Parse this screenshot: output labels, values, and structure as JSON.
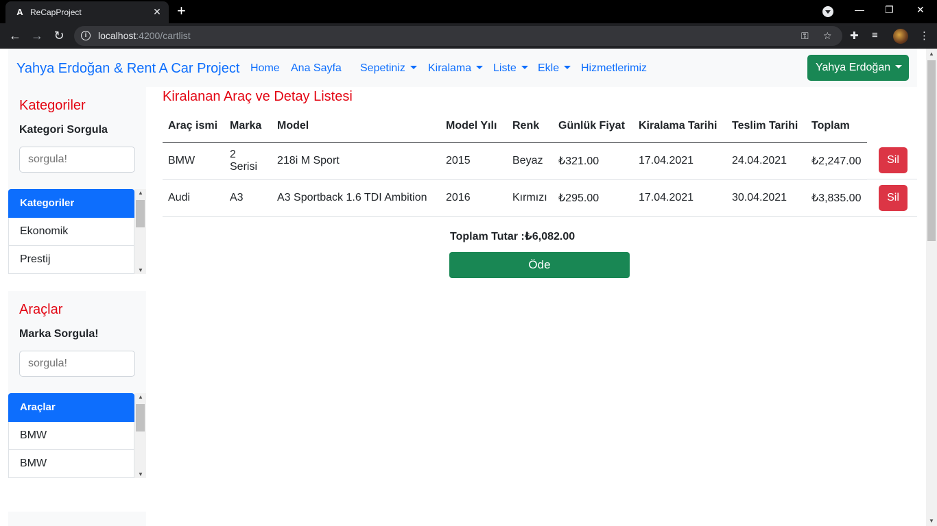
{
  "browser": {
    "tab_title": "ReCapProject",
    "tab_favicon": "A",
    "url_host": "localhost",
    "url_rest": ":4200/cartlist"
  },
  "navbar": {
    "brand": "Yahya Erdoğan & Rent A Car Project",
    "links": [
      "Home",
      "Ana Sayfa"
    ],
    "dropdowns": [
      "Sepetiniz",
      "Kiralama",
      "Liste",
      "Ekle"
    ],
    "services": "Hizmetlerimiz",
    "user_button": "Yahya Erdoğan"
  },
  "sidebar": {
    "categories": {
      "title": "Kategoriler",
      "label": "Kategori Sorgula",
      "placeholder": "sorgula!",
      "active": "Kategoriler",
      "items": [
        "Ekonomik",
        "Prestij"
      ]
    },
    "cars": {
      "title": "Araçlar",
      "label": "Marka Sorgula!",
      "placeholder": "sorgula!",
      "active": "Araçlar",
      "items": [
        "BMW",
        "BMW"
      ]
    }
  },
  "main": {
    "title": "Kiralanan Araç ve Detay Listesi",
    "columns": [
      "Araç ismi",
      "Marka",
      "Model",
      "Model Yılı",
      "Renk",
      "Günlük Fiyat",
      "Kiralama Tarihi",
      "Teslim Tarihi",
      "Toplam"
    ],
    "rows": [
      [
        "BMW",
        "2 Serisi",
        "218i M Sport",
        "2015",
        "Beyaz",
        "₺321.00",
        "17.04.2021",
        "24.04.2021",
        "₺2,247.00"
      ],
      [
        "Audi",
        "A3",
        "A3 Sportback 1.6 TDI Ambition",
        "2016",
        "Kırmızı",
        "₺295.00",
        "17.04.2021",
        "30.04.2021",
        "₺3,835.00"
      ]
    ],
    "delete_label": "Sil",
    "total_label": "Toplam Tutar :₺6,082.00",
    "pay_label": "Öde"
  },
  "colors": {
    "primary": "#0d6efd",
    "success": "#198754",
    "danger": "#dc3545",
    "title_red": "#e30613"
  }
}
